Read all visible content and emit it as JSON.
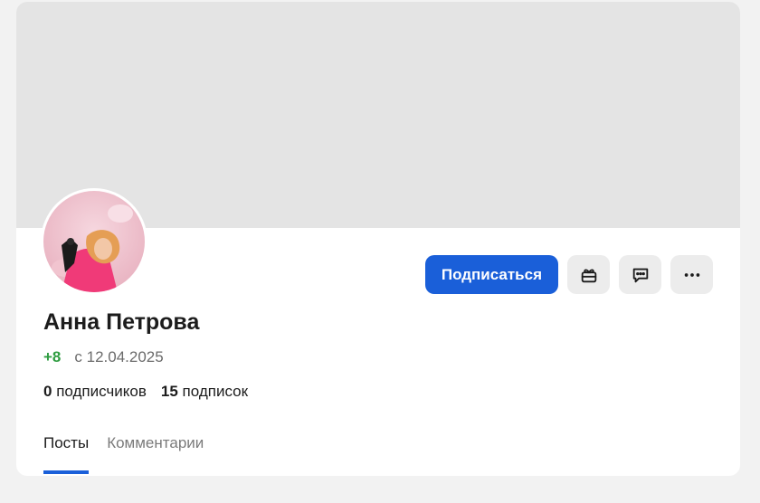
{
  "profile": {
    "name": "Анна Петрова",
    "rating": "+8",
    "since": "с 12.04.2025",
    "followers_count": "0",
    "followers_label": "подписчиков",
    "following_count": "15",
    "following_label": "подписок"
  },
  "actions": {
    "subscribe_label": "Подписаться",
    "icons": [
      "gift-icon",
      "message-icon",
      "more-icon"
    ]
  },
  "tabs": [
    {
      "label": "Посты",
      "active": true
    },
    {
      "label": "Комментарии",
      "active": false
    }
  ],
  "colors": {
    "accent": "#1a5fd9",
    "rating": "#2e9c40",
    "cover": "#e4e4e4",
    "background": "#f2f2f2"
  }
}
